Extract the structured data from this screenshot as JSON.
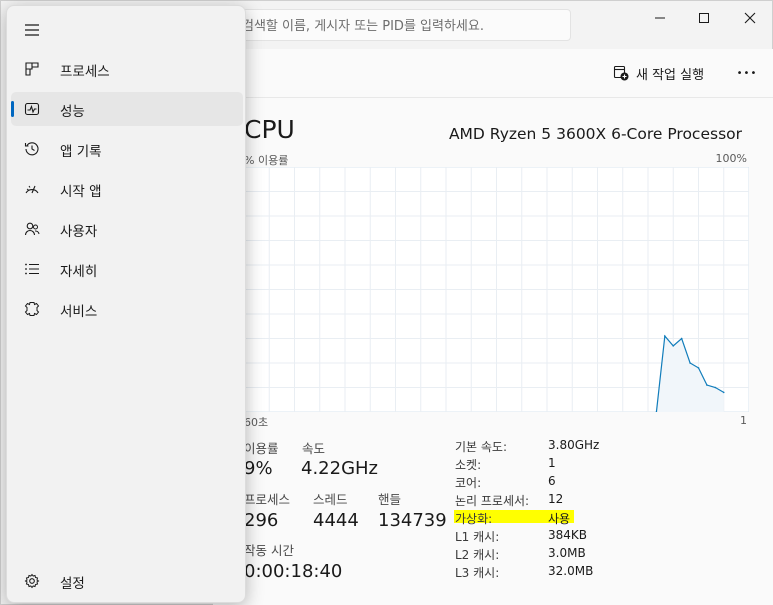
{
  "search": {
    "placeholder": "검색할 이름, 게시자 또는 PID를 입력하세요."
  },
  "toolbar": {
    "run_task_label": "새 작업 실행",
    "more_label": "•••"
  },
  "cpu": {
    "title": "CPU",
    "model": "AMD Ryzen 5 3600X 6-Core Processor",
    "axis": {
      "top_left": "% 이용률",
      "top_right": "100%",
      "bottom_left": "60초",
      "bottom_right": "1"
    }
  },
  "chart_data": {
    "type": "area",
    "x": [
      0,
      1,
      2,
      3,
      4,
      5,
      6,
      7,
      8,
      9,
      10,
      11,
      12,
      13,
      14,
      15,
      16,
      17,
      18,
      19,
      20,
      21,
      22,
      23,
      24,
      25,
      26,
      27,
      28,
      29,
      30,
      31,
      32,
      33,
      34,
      35,
      36,
      37,
      38,
      39,
      40,
      41,
      42,
      43,
      44,
      45,
      46,
      47,
      48,
      49,
      50,
      51,
      52,
      53,
      54,
      55,
      56,
      57,
      58,
      59,
      60
    ],
    "values": [
      null,
      null,
      null,
      null,
      null,
      null,
      null,
      null,
      null,
      null,
      null,
      null,
      null,
      null,
      null,
      null,
      null,
      null,
      null,
      null,
      null,
      null,
      null,
      null,
      null,
      null,
      null,
      null,
      null,
      null,
      null,
      null,
      null,
      null,
      null,
      null,
      null,
      null,
      null,
      null,
      null,
      null,
      null,
      null,
      null,
      null,
      null,
      null,
      null,
      0,
      31,
      27,
      30,
      20,
      18,
      11,
      10,
      8
    ],
    "xlabel": "60초",
    "ylabel": "% 이용률",
    "ylim": [
      0,
      100
    ],
    "color": "#117dbb",
    "fill": "#f1f6fa",
    "grid": true
  },
  "stats": {
    "utilization": {
      "label": "이용률",
      "value": "9%"
    },
    "speed": {
      "label": "속도",
      "value": "4.22GHz"
    },
    "processes": {
      "label": "프로세스",
      "value": "296"
    },
    "threads": {
      "label": "스레드",
      "value": "4444"
    },
    "handles": {
      "label": "핸들",
      "value": "134739"
    },
    "uptime": {
      "label": "작동 시간",
      "value": "0:00:18:40"
    }
  },
  "specs": [
    {
      "label": "기본 속도:",
      "value": "3.80GHz"
    },
    {
      "label": "소켓:",
      "value": "1"
    },
    {
      "label": "코어:",
      "value": "6"
    },
    {
      "label": "논리 프로세서:",
      "value": "12"
    },
    {
      "label": "가상화:",
      "value": "사용"
    },
    {
      "label": "L1 캐시:",
      "value": "384KB"
    },
    {
      "label": "L2 캐시:",
      "value": "3.0MB"
    },
    {
      "label": "L3 캐시:",
      "value": "32.0MB"
    }
  ],
  "sidebar": {
    "items": [
      {
        "label": "프로세스",
        "icon": "processes-icon"
      },
      {
        "label": "성능",
        "icon": "performance-icon",
        "active": true
      },
      {
        "label": "앱 기록",
        "icon": "app-history-icon"
      },
      {
        "label": "시작 앱",
        "icon": "startup-apps-icon"
      },
      {
        "label": "사용자",
        "icon": "users-icon"
      },
      {
        "label": "자세히",
        "icon": "details-icon"
      },
      {
        "label": "서비스",
        "icon": "services-icon"
      }
    ],
    "settings_label": "설정"
  },
  "colors": {
    "accent": "#0067c0",
    "highlight": "#ffff00",
    "graph_line": "#117dbb"
  }
}
